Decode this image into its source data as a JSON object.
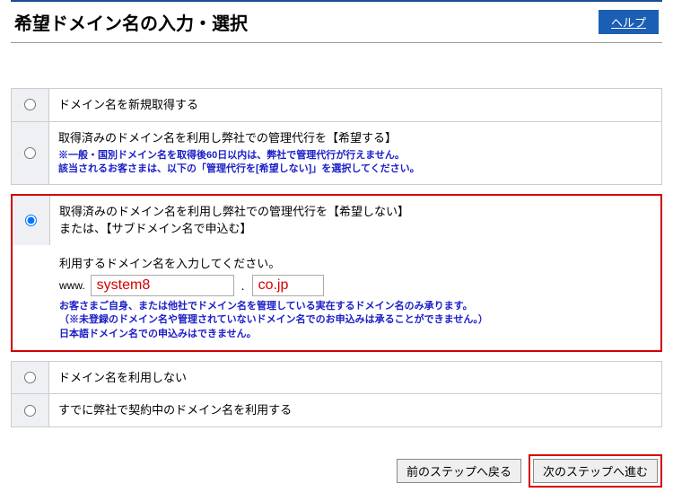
{
  "header": {
    "title": "希望ドメイン名の入力・選択",
    "help_label": "ヘルプ"
  },
  "options": {
    "opt1": {
      "label": "ドメイン名を新規取得する"
    },
    "opt2": {
      "label": "取得済みのドメイン名を利用し弊社での管理代行を【希望する】",
      "note_line1": "※一般・国別ドメイン名を取得後60日以内は、弊社で管理代行が行えません。",
      "note_line2": "該当されるお客さまは、以下の「管理代行を[希望しない]」を選択してください。"
    },
    "opt3": {
      "label_line1": "取得済みのドメイン名を利用し弊社での管理代行を【希望しない】",
      "label_line2": "または、【サブドメイン名で申込む】",
      "input_prompt": "利用するドメイン名を入力してください。",
      "www_prefix": "www.",
      "domain_value": "system8",
      "tld_value": "co.jp",
      "dot": ".",
      "note_line1": "お客さまご自身、または他社でドメイン名を管理している実在するドメイン名のみ承ります。",
      "note_line2": "（※未登録のドメイン名や管理されていないドメイン名でのお申込みは承ることができません。）",
      "note_line3": "日本語ドメイン名での申込みはできません。"
    },
    "opt4": {
      "label": "ドメイン名を利用しない"
    },
    "opt5": {
      "label": "すでに弊社で契約中のドメイン名を利用する"
    }
  },
  "buttons": {
    "prev": "前のステップへ戻る",
    "next": "次のステップへ進む"
  }
}
